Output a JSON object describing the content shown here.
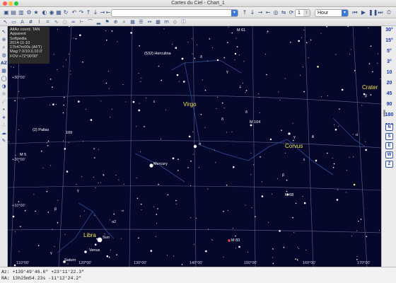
{
  "window": {
    "title": "Cartes du Ciel - Chart_1"
  },
  "toolbar": {
    "top_icons": [
      "folder-icon",
      "save-icon",
      "print-icon",
      "config-icon",
      "star-icon",
      "planet-icon",
      "eye-icon",
      "image-icon",
      "refresh-icon",
      "undo-icon",
      "redo-icon",
      "north-icon",
      "south-icon",
      "east-icon",
      "west-icon",
      "zenith-icon",
      "flip-icon",
      "rotate-icon"
    ],
    "combo1": "",
    "stepper_value": "1",
    "time_unit": "Hour",
    "second_row_icons": [
      "pointer-icon",
      "select-icon",
      "label-icon",
      "grid-icon",
      "constellation-line-icon",
      "boundary-icon",
      "ecliptic-icon",
      "galactic-icon",
      "milky-way-icon",
      "scale-icon",
      "horizon-icon",
      "ground-icon",
      "flag-icon",
      "telescope-icon",
      "search-icon",
      "calendar-icon",
      "list-icon",
      "measure-icon",
      "dss-icon",
      "magnitude-icon",
      "projection-icon",
      "info-icon"
    ]
  },
  "left_toolbar": [
    "cursor-icon",
    "target-icon",
    "zoom-icon",
    "eq-icon",
    "alt-az-icon",
    "grid-icon",
    "orbit-icon",
    "moon-icon",
    "sun-icon",
    "comet-icon",
    "asteroid-icon",
    "variable-icon",
    "double-icon",
    "nebula-icon",
    "pen-icon"
  ],
  "left_toolbar_label": "AZ",
  "fov_buttons": [
    "30°",
    "15°",
    "5°",
    "3°",
    "10",
    "20",
    "45",
    "90",
    "180",
    "310"
  ],
  "nav_buttons": [
    "N",
    "S",
    "E",
    "W",
    "Z"
  ],
  "info_panel": [
    "AltAz coord. TAN",
    "Apparent",
    "Softpedia",
    "2014-11-10",
    "17h47m00s (AFT)",
    "Mag:7.0/10.0,10.0'",
    "FOV:+72°00'00\""
  ],
  "sky": {
    "constellations": [
      "Virgo",
      "Corvus",
      "Libra",
      "Crater"
    ],
    "objects": [
      "(532) Herculina",
      "(2) Pallas",
      "Mercury",
      "Venus",
      "Saturn",
      "Sun",
      "M 104",
      "M 68",
      "M 83",
      "M 5",
      "M 61",
      "109"
    ],
    "greek_labels": [
      "δ",
      "γ",
      "ε",
      "δ",
      "α",
      "γ",
      "β",
      "β",
      "α2",
      "γ",
      "δ",
      "ε",
      "γ",
      "δ",
      "β",
      "α"
    ],
    "dec_labels": [
      "+30°00'",
      "+20°00'",
      "+10°00'"
    ],
    "ra_labels": [
      "110°00'",
      "120°00'",
      "130°00'",
      "140°00'",
      "150°00'",
      "160°00'",
      "170°00'"
    ],
    "colors": {
      "background": "#05082a",
      "grid": "#5a6890",
      "constellation_label": "#f1e04a",
      "object_label": "#ffffff",
      "constellation_line": "#2f4f9e"
    }
  },
  "status": {
    "line1": "Az: +139°49'46.6\" +23°11'22.3\"",
    "line2": "RA: 13h25m54.23s -11°12'24.2\""
  }
}
